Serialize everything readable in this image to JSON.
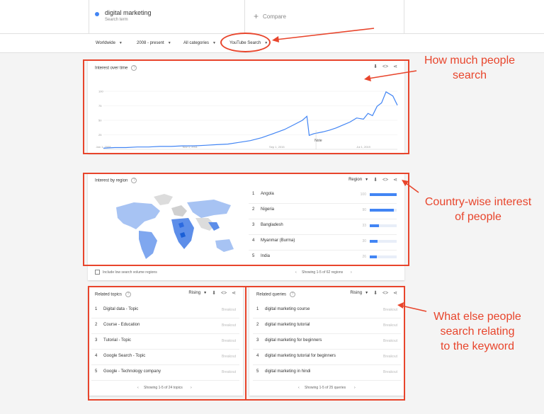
{
  "search_term": {
    "name": "digital marketing",
    "sub": "Search term"
  },
  "compare": {
    "plus": "+",
    "label": "Compare"
  },
  "filters": [
    {
      "label": "Worldwide"
    },
    {
      "label": "2008 - present"
    },
    {
      "label": "All categories"
    },
    {
      "label": "YouTube Search"
    }
  ],
  "interest_over_time": {
    "title": "Interest over time",
    "note": "Note"
  },
  "chart_data": {
    "type": "line",
    "title": "Interest over time",
    "xlabel": "",
    "ylabel": "",
    "ylim": [
      0,
      100
    ],
    "ticks_y": [
      "100",
      "75",
      "50",
      "25"
    ],
    "ticks_x": [
      "Jan 1, 2008",
      "Nov 1, 2011",
      "Sep 1, 2015",
      "Jul 1, 2019"
    ],
    "x": [
      2008.0,
      2008.5,
      2009.0,
      2009.5,
      2010.0,
      2010.5,
      2011.0,
      2011.5,
      2012.0,
      2012.5,
      2013.0,
      2013.5,
      2014.0,
      2014.5,
      2015.0,
      2015.5,
      2016.0,
      2016.4,
      2016.8,
      2017.0,
      2017.1,
      2017.3,
      2017.7,
      2018.0,
      2018.3,
      2018.6,
      2018.9,
      2019.2,
      2019.5,
      2019.7,
      2019.9,
      2020.1,
      2020.3,
      2020.5,
      2020.8,
      2021.0
    ],
    "series": [
      {
        "values": [
          2,
          3,
          3,
          4,
          4,
          5,
          5,
          6,
          6,
          7,
          8,
          9,
          12,
          15,
          20,
          27,
          34,
          42,
          50,
          57,
          24,
          27,
          30,
          33,
          37,
          42,
          47,
          54,
          52,
          62,
          58,
          74,
          80,
          99,
          92,
          76
        ]
      }
    ]
  },
  "interest_by_region": {
    "title": "Interest by region",
    "selector": "Region",
    "rows": [
      {
        "rank": "1",
        "name": "Angola",
        "value": 100
      },
      {
        "rank": "2",
        "name": "Nigeria",
        "value": 90
      },
      {
        "rank": "3",
        "name": "Bangladesh",
        "value": 33
      },
      {
        "rank": "4",
        "name": "Myanmar (Burma)",
        "value": 30
      },
      {
        "rank": "5",
        "name": "India",
        "value": 26
      }
    ],
    "checkbox_label": "Include low search volume regions",
    "pager": "Showing 1-5 of 62 regions"
  },
  "related_topics": {
    "title": "Related topics",
    "selector": "Rising",
    "rows": [
      {
        "rank": "1",
        "name": "Digital data - Topic",
        "value": "Breakout"
      },
      {
        "rank": "2",
        "name": "Course - Education",
        "value": "Breakout"
      },
      {
        "rank": "3",
        "name": "Tutorial - Topic",
        "value": "Breakout"
      },
      {
        "rank": "4",
        "name": "Google Search - Topic",
        "value": "Breakout"
      },
      {
        "rank": "5",
        "name": "Google - Technology company",
        "value": "Breakout"
      }
    ],
    "pager": "Showing 1-5 of 24 topics"
  },
  "related_queries": {
    "title": "Related queries",
    "selector": "Rising",
    "rows": [
      {
        "rank": "1",
        "name": "digital marketing course",
        "value": "Breakout"
      },
      {
        "rank": "2",
        "name": "digital marketing tutorial",
        "value": "Breakout"
      },
      {
        "rank": "3",
        "name": "digital marketing for beginners",
        "value": "Breakout"
      },
      {
        "rank": "4",
        "name": "digital marketing tutorial for beginners",
        "value": "Breakout"
      },
      {
        "rank": "5",
        "name": "digital marketing in hindi",
        "value": "Breakout"
      }
    ],
    "pager": "Showing 1-5 of 25 queries"
  },
  "annotations": {
    "a1_l1": "How much people",
    "a1_l2": "search",
    "a2_l1": "Country-wise interest",
    "a2_l2": "of people",
    "a3_l1": "What else people",
    "a3_l2": "search relating",
    "a3_l3": "to the keyword"
  },
  "colors": {
    "accent": "#4285f4",
    "annotation": "#e8452c"
  }
}
